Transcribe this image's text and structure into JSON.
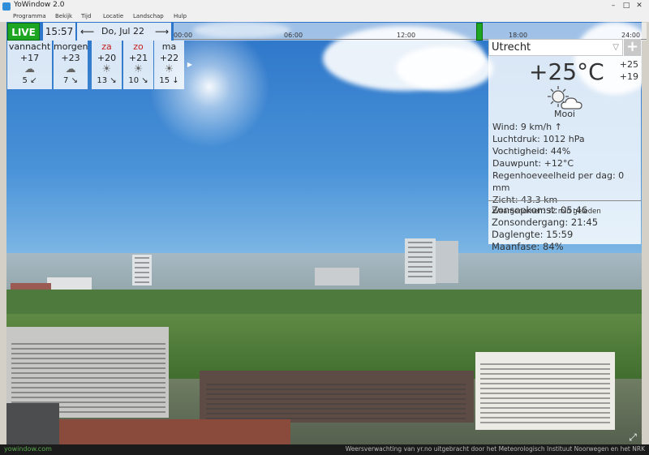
{
  "window": {
    "title": "YoWindow 2.0",
    "minimize": "–",
    "maximize": "□",
    "close": "✕"
  },
  "menu": [
    "Programma",
    "Bekijk",
    "Tijd",
    "Locatie",
    "Landschap",
    "Hulp"
  ],
  "topbar": {
    "live_label": "LIVE",
    "time": "15:57",
    "prev_arrow": "⟵",
    "date": "Do, Jul 22",
    "next_arrow": "⟶",
    "timeline_labels": [
      "00:00",
      "06:00",
      "12:00",
      "18:00",
      "24:00"
    ]
  },
  "forecast": [
    {
      "name": "vannacht",
      "temp": "+17",
      "icon": "☁",
      "wind": "5 ↙",
      "weekend": false
    },
    {
      "name": "morgen",
      "temp": "+23",
      "icon": "☁",
      "wind": "7 ↘",
      "weekend": false
    },
    {
      "name": "za",
      "temp": "+20",
      "icon": "☀",
      "wind": "13 ↘",
      "weekend": true
    },
    {
      "name": "zo",
      "temp": "+21",
      "icon": "☀",
      "wind": "10 ↘",
      "weekend": true
    },
    {
      "name": "ma",
      "temp": "+22",
      "icon": "☀",
      "wind": "15 ↓",
      "weekend": false
    }
  ],
  "forecast_next": "▶",
  "current": {
    "city": "Utrecht",
    "dropdown_icon": "▽",
    "add_icon": "+",
    "temp": "+25°C",
    "high": "+25",
    "low": "+19",
    "condition": "Mooi",
    "wind": "Wind:  9 km/h  ↑",
    "pressure": "Luchtdruk:  1012 hPa",
    "humidity": "Vochtigheid:  44%",
    "dewpoint": "Dauwpunt:  +12°C",
    "precip": "Regenhoeveelheid per dag:  0 mm",
    "visibility": "Zicht:  43.3 km",
    "observed": "Waargenomen:  32 min geleden"
  },
  "astro": {
    "sunrise": "Zonsopkomst:  05:46",
    "sunset": "Zonsondergang:  21:45",
    "daylength": "Daglengte:  15:59",
    "moonphase": "Maanfase:  84%"
  },
  "footer": {
    "left": "yowindow.com",
    "right": "Weersverwachting van yr.no uitgebracht door het Meteorologisch Instituut Noorwegen en het NRK"
  },
  "colors": {
    "live_green": "#1ea622",
    "weekend_red": "#c81e1e",
    "sky_blue": "#4a93d8"
  }
}
